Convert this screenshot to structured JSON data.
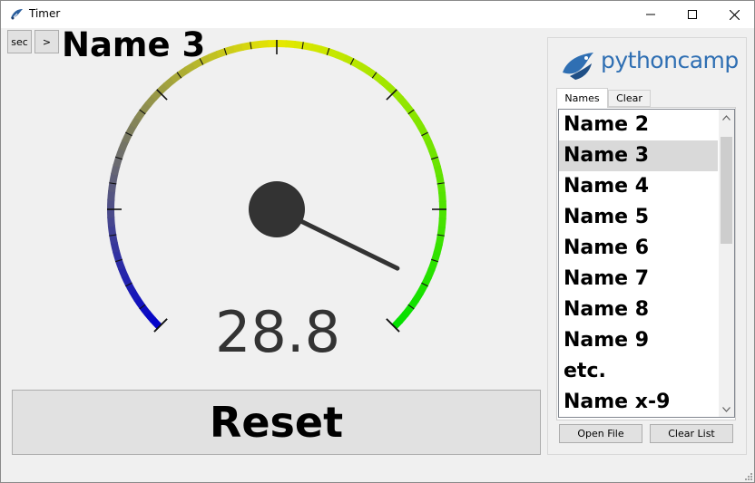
{
  "window": {
    "title": "Timer",
    "icon": "python-feather-icon"
  },
  "toolbar": {
    "unit_label": "sec",
    "next_label": ">"
  },
  "current_name": "Name 3",
  "gauge": {
    "value": 28.8,
    "value_text": "28.8",
    "needle_fraction": 0.93,
    "colors": {
      "low": "#0000cc",
      "mid": "#e8e800",
      "high": "#00e000",
      "hub": "#333333"
    }
  },
  "reset_label": "Reset",
  "logo": {
    "text_a": "python",
    "text_b": "camp",
    "color": "#2f6fb3"
  },
  "tabs": [
    {
      "label": "Names",
      "active": true
    },
    {
      "label": "Clear",
      "active": false
    }
  ],
  "names_list": {
    "items": [
      "Name 2",
      "Name 3",
      "Name 4",
      "Name 5",
      "Name 6",
      "Name 7",
      "Name 8",
      "Name 9",
      "etc.",
      "Name x-9"
    ],
    "selected": "Name 3"
  },
  "buttons": {
    "open_file": "Open File",
    "clear_list": "Clear List"
  }
}
